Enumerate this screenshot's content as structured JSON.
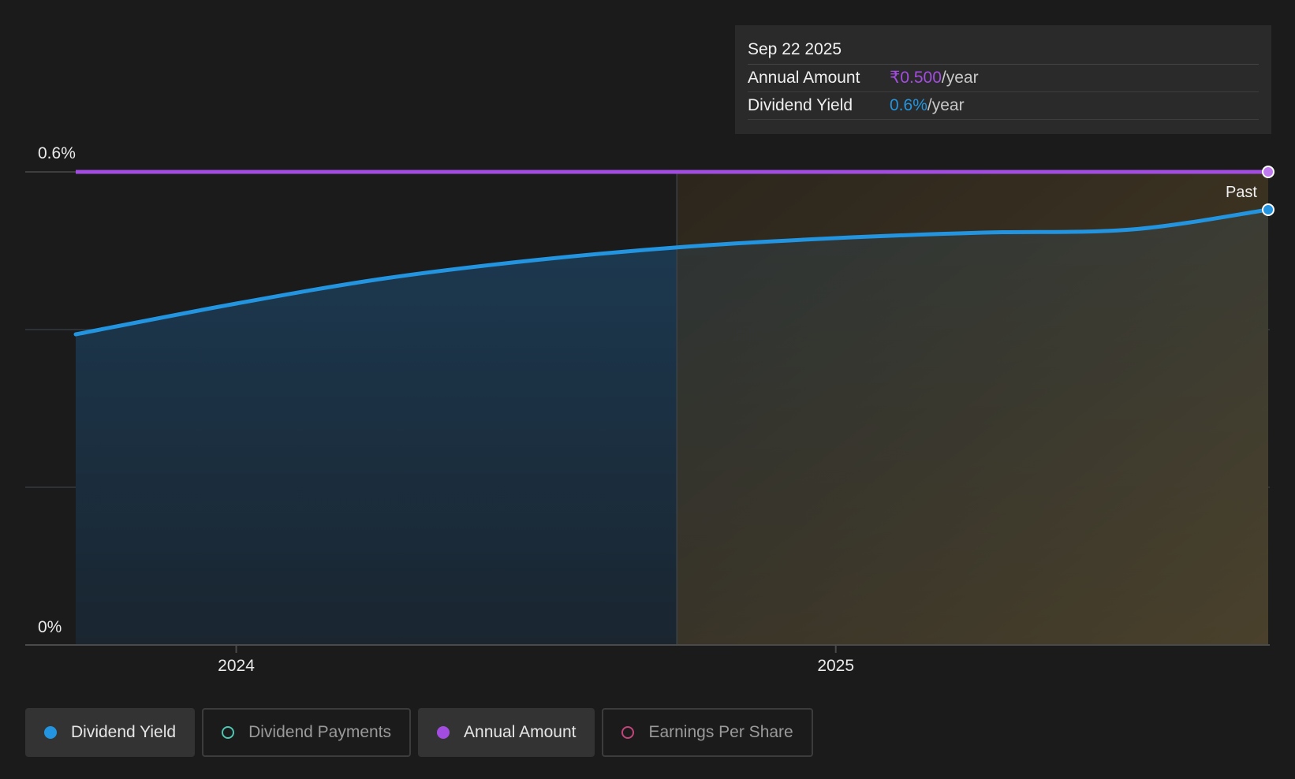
{
  "chart_data": {
    "type": "area",
    "y_axis": {
      "ticks": [
        "0.6%",
        "0%"
      ],
      "ylim": [
        0,
        0.6
      ]
    },
    "x_axis": {
      "ticks": [
        "2024",
        "2025"
      ]
    },
    "past_label": "Past",
    "series": [
      {
        "name": "Dividend Yield",
        "color": "#2394df",
        "unit": "%",
        "points": [
          {
            "x": "2023-09-25",
            "y": 0.394
          },
          {
            "x": "2024-01-01",
            "y": 0.433
          },
          {
            "x": "2024-04-01",
            "y": 0.465
          },
          {
            "x": "2024-07-01",
            "y": 0.488
          },
          {
            "x": "2024-10-01",
            "y": 0.505
          },
          {
            "x": "2025-01-01",
            "y": 0.516
          },
          {
            "x": "2025-04-01",
            "y": 0.523
          },
          {
            "x": "2025-07-01",
            "y": 0.527
          },
          {
            "x": "2025-09-22",
            "y": 0.552
          }
        ]
      },
      {
        "name": "Annual Amount",
        "color": "#a34de0",
        "unit": "₹/year",
        "points": [
          {
            "x": "2023-09-25",
            "y": 0.5
          },
          {
            "x": "2025-09-22",
            "y": 0.5
          }
        ]
      }
    ],
    "forecast_start": "2024-09-26"
  },
  "tooltip": {
    "date": "Sep 22 2025",
    "rows": [
      {
        "label": "Annual Amount",
        "value": "₹0.500",
        "unit": "/year",
        "color": "#a34de0"
      },
      {
        "label": "Dividend Yield",
        "value": "0.6%",
        "unit": "/year",
        "color": "#2394df"
      }
    ]
  },
  "legend": [
    {
      "label": "Dividend Yield",
      "active": true,
      "dot_color": "#2394df",
      "dot_style": "filled"
    },
    {
      "label": "Dividend Payments",
      "active": false,
      "dot_color": "#4fc5b3",
      "dot_style": "outline"
    },
    {
      "label": "Annual Amount",
      "active": true,
      "dot_color": "#a34de0",
      "dot_style": "filled"
    },
    {
      "label": "Earnings Per Share",
      "active": false,
      "dot_color": "#c2457d",
      "dot_style": "outline"
    }
  ]
}
